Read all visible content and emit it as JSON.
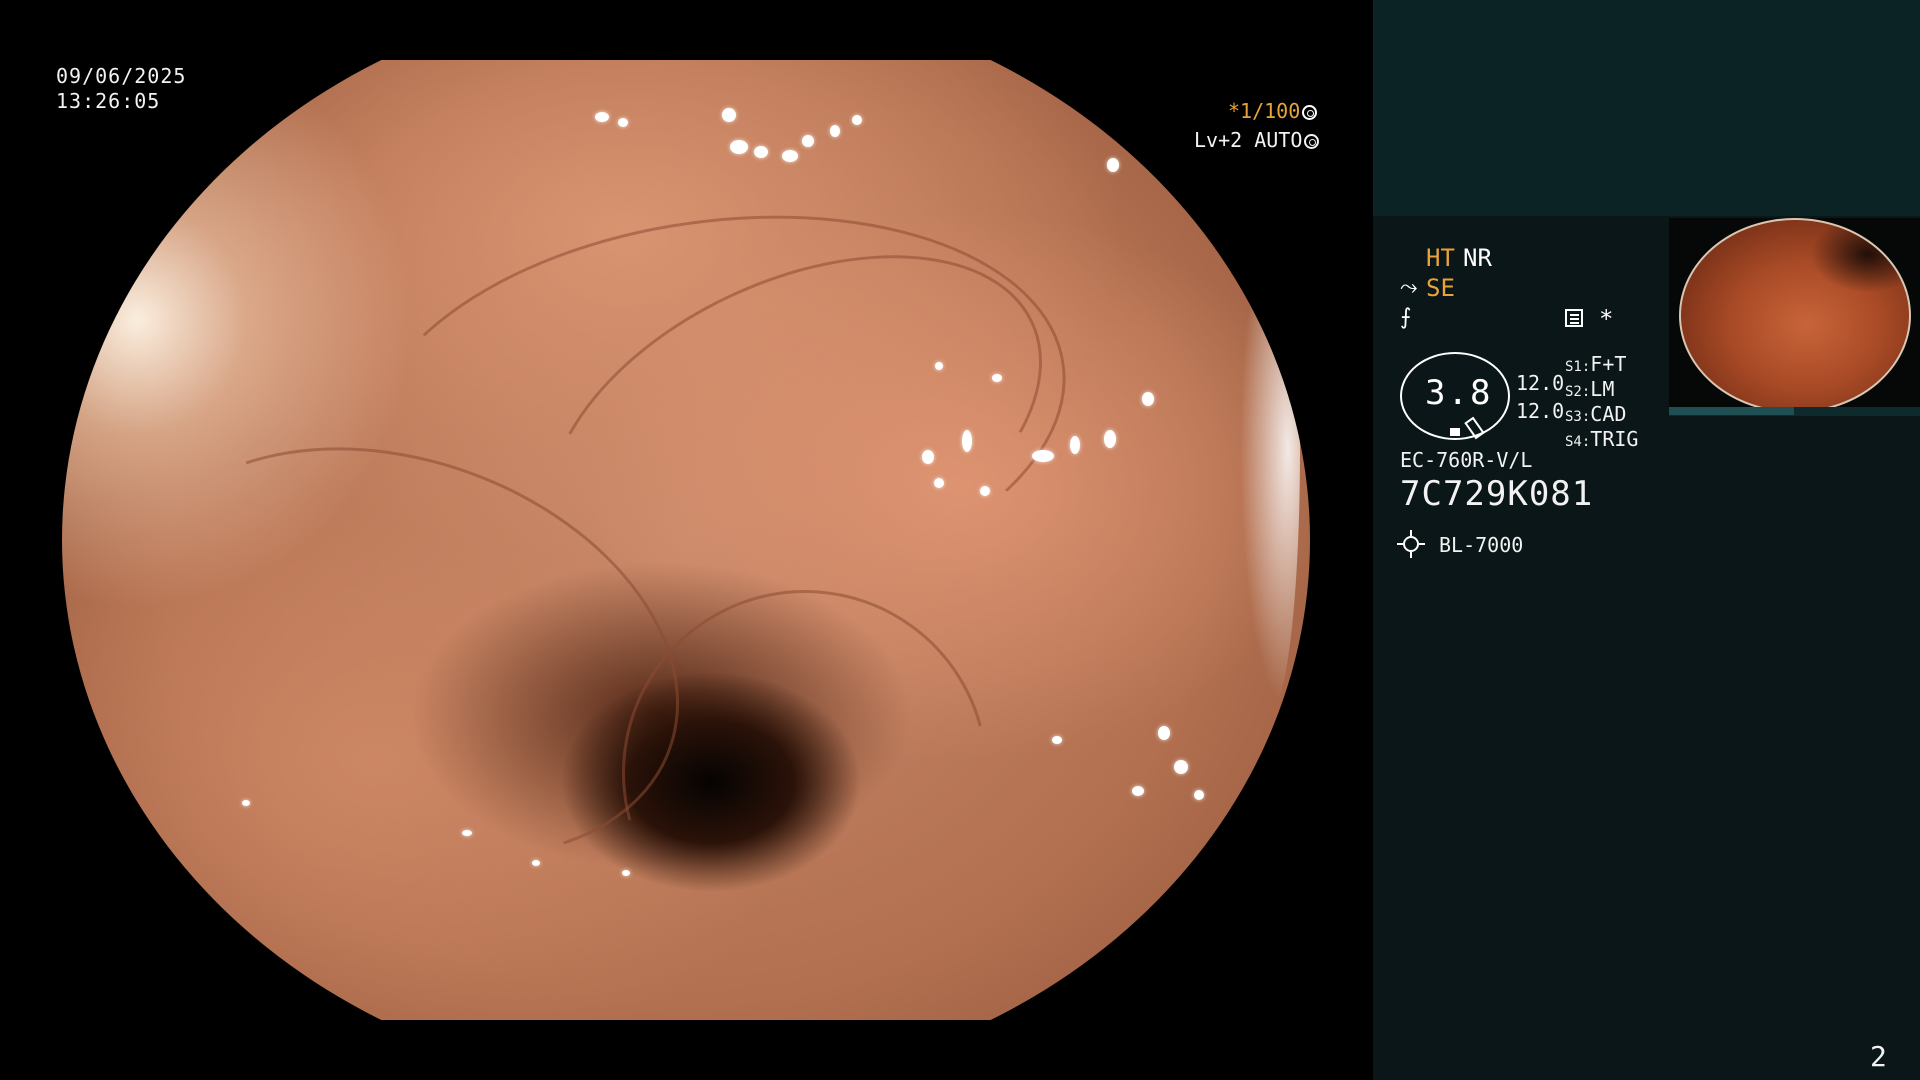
{
  "scope_overlay": {
    "date": "09/06/2025",
    "time": "13:26:05",
    "shutter": "*1/100",
    "level": "Lv+2 AUTO"
  },
  "info_panel": {
    "ht_label": "HT",
    "nr_label": "NR",
    "se_label": "SE",
    "asterisk": "*",
    "ratio_value": "3.8",
    "value_a": "12.0",
    "value_b": "12.0",
    "switches": [
      {
        "label": "S1:",
        "value": "F+T"
      },
      {
        "label": "S2:",
        "value": "LM"
      },
      {
        "label": "S3:",
        "value": "CAD"
      },
      {
        "label": "S4:",
        "value": "TRIG"
      }
    ],
    "scope_model": "EC-760R-V/L",
    "scope_serial": "7C729K081",
    "light_source": "BL-7000"
  },
  "page_number": "2",
  "colors": {
    "accent_orange": "#e8a33a",
    "panel_bg": "#0a1617",
    "panel_header_bg": "#0c2326"
  }
}
